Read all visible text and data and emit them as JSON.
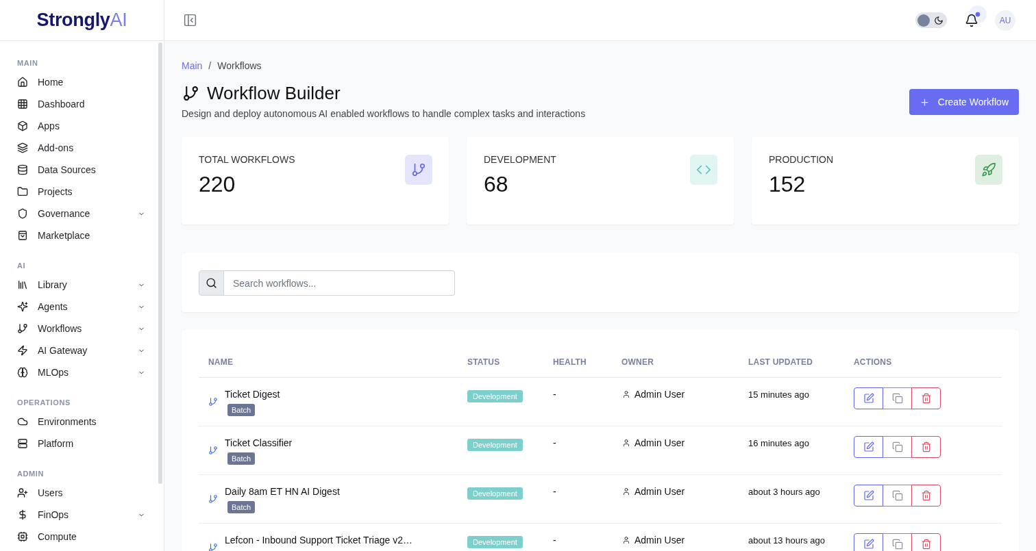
{
  "sidebar": {
    "logo": "**Strongly**AI",
    "sections": [
      {
        "title": "MAIN",
        "items": [
          {
            "label": "Home",
            "kind": "link",
            "selected": false
          },
          {
            "label": "Dashboard",
            "kind": "link",
            "selected": false
          },
          {
            "label": "Apps",
            "kind": "link",
            "selected": false
          },
          {
            "label": "Add-ons",
            "kind": "link",
            "selected": false
          },
          {
            "label": "Data Sources",
            "kind": "link",
            "selected": false
          },
          {
            "label": "Projects",
            "kind": "link",
            "selected": false
          },
          {
            "label": "Governance",
            "kind": "group",
            "expanded": false,
            "selected": false
          },
          {
            "label": "Marketplace",
            "kind": "link",
            "selected": false
          }
        ]
      },
      {
        "title": "AI",
        "items": [
          {
            "label": "Library",
            "kind": "group",
            "expanded": false,
            "selected": false
          },
          {
            "label": "Agents",
            "kind": "group",
            "expanded": false,
            "selected": false
          },
          {
            "label": "Workflows",
            "kind": "group",
            "expanded": false,
            "selected": false
          },
          {
            "label": "AI Gateway",
            "kind": "group",
            "expanded": false,
            "selected": false
          },
          {
            "label": "MLOps",
            "kind": "group",
            "expanded": false,
            "selected": false
          }
        ]
      },
      {
        "title": "OPERATIONS",
        "items": [
          {
            "label": "Environments",
            "kind": "link",
            "selected": false
          },
          {
            "label": "Platform",
            "kind": "link",
            "selected": false
          }
        ]
      },
      {
        "title": "ADMIN",
        "items": [
          {
            "label": "Users",
            "kind": "link",
            "selected": false
          },
          {
            "label": "FinOps",
            "kind": "group",
            "expanded": false,
            "selected": false
          },
          {
            "label": "Compute",
            "kind": "link",
            "selected": false
          }
        ]
      }
    ]
  },
  "header": {
    "theme_toggle": {
      "on": false
    },
    "notifications": {
      "unread": true
    },
    "avatar": "AU"
  },
  "breadcrumb": {
    "items": [
      {
        "label": "Main",
        "kind": "link"
      },
      {
        "label": "Workflows",
        "kind": "current"
      }
    ],
    "separator": "/"
  },
  "page": {
    "title": "Workflow Builder",
    "subtitle": "Design and deploy autonomous AI enabled workflows to handle complex tasks and interactions",
    "primary_button": "Create Workflow"
  },
  "stats": [
    {
      "label": "TOTAL WORKFLOWS",
      "value": "220"
    },
    {
      "label": "DEVELOPMENT",
      "value": "68"
    },
    {
      "label": "PRODUCTION",
      "value": "152"
    }
  ],
  "search": {
    "placeholder": "Search workflows..."
  },
  "table": {
    "columns": [
      "NAME",
      "STATUS",
      "HEALTH",
      "OWNER",
      "LAST UPDATED",
      "ACTIONS"
    ],
    "rows": [
      {
        "name": "Ticket Digest",
        "type": "Batch",
        "status": "Development",
        "health": "-",
        "owner": "Admin User",
        "updated": "15 minutes ago"
      },
      {
        "name": "Ticket Classifier",
        "type": "Batch",
        "status": "Development",
        "health": "-",
        "owner": "Admin User",
        "updated": "16 minutes ago"
      },
      {
        "name": "Daily 8am ET HN AI Digest",
        "type": "Batch",
        "status": "Development",
        "health": "-",
        "owner": "Admin User",
        "updated": "about 3 hours ago"
      },
      {
        "name": "Lefcon - Inbound Support Ticket Triage v2…",
        "status": "Development",
        "health": "-",
        "owner": "Admin User",
        "updated": "about 13 hours ago"
      }
    ]
  }
}
